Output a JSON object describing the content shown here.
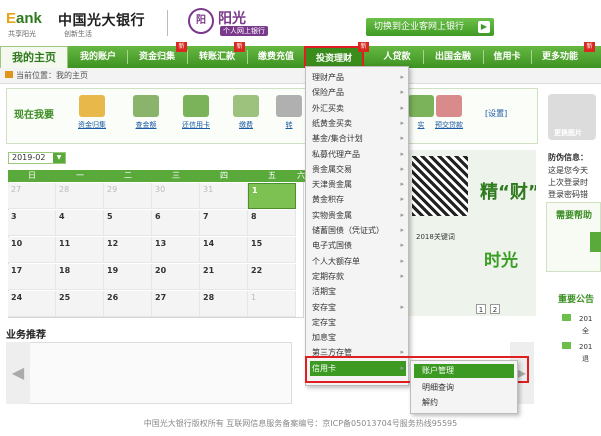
{
  "header": {
    "logo_e": "E",
    "logo_bank": "ank",
    "bank_name": "中国光大银行",
    "slogan_left": "共享阳光",
    "slogan_right": "创新生活",
    "partner_seal": "阳",
    "partner_name": "阳光",
    "partner_sub": "个人网上银行",
    "switch_button": "切换到企业客网上银行"
  },
  "nav": {
    "items": [
      "我的主页",
      "我的账户",
      "资金归集",
      "转账汇款",
      "缴费充值",
      "投资理财",
      "人贷款",
      "出国金融",
      "信用卡",
      "更多功能"
    ],
    "new_badge": "新"
  },
  "breadcrumb": "当前位置：我的主页",
  "quick": {
    "title": "现在我要",
    "items": [
      "资金归集",
      "查金额",
      "还信用卡",
      "缴费",
      "转",
      "实",
      "慧",
      "预交贷款"
    ],
    "settings": "[设置]"
  },
  "calendar": {
    "month_select": "2019-02",
    "weekdays": [
      "日",
      "一",
      "二",
      "三",
      "四",
      "五",
      "六"
    ],
    "weeks": [
      [
        "27",
        "28",
        "29",
        "30",
        "31",
        "1",
        "2"
      ],
      [
        "3",
        "4",
        "5",
        "6",
        "7",
        "8",
        "9"
      ],
      [
        "10",
        "11",
        "12",
        "13",
        "14",
        "15",
        "16"
      ],
      [
        "17",
        "18",
        "19",
        "20",
        "21",
        "22",
        "23"
      ],
      [
        "24",
        "25",
        "26",
        "27",
        "28",
        "1",
        "2"
      ]
    ]
  },
  "promo": {
    "big_text": "精“财”",
    "time_text": "时光",
    "caption": "2018关键词",
    "pager": [
      "1",
      "2"
    ]
  },
  "recommend": {
    "title": "业务推荐",
    "prev": "◀",
    "next": "▸"
  },
  "right": {
    "avatar_label": "更换图片",
    "lines": [
      "防伪信息：",
      "这是您今天",
      "上次登录时",
      "登录密码错"
    ],
    "help_title": "需要帮助",
    "notice_title": "重要公告",
    "notices": [
      "201",
      "全",
      "201",
      "退"
    ]
  },
  "menu": {
    "items": [
      "理财产品",
      "保险产品",
      "外汇买卖",
      "纸黄金买卖",
      "基金/集合计划",
      "私募代理产品",
      "贵金属交易",
      "天津贵金属",
      "黄金积存",
      "实物贵金属",
      "储蓄国债（凭证式）",
      "电子式国债",
      "个人大额存单",
      "定期存款",
      "活期宝",
      "安存宝",
      "定存宝",
      "加息宝",
      "第三方存管",
      "信用卡"
    ],
    "submenu": [
      "账户管理",
      "明细查询",
      "解约"
    ]
  },
  "footer": "中国光大银行版权所有  互联网信息服务备案编号：京ICP备05013704号服务热线95595"
}
